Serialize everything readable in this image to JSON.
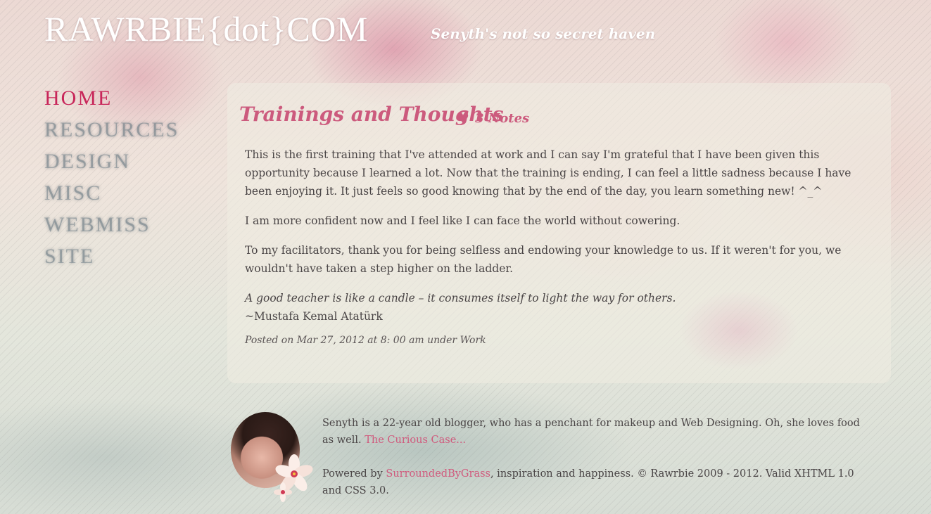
{
  "header": {
    "site_title": "RAWRBIE{dot}COM",
    "tagline": "Senyth's not so secret haven"
  },
  "nav": {
    "items": [
      {
        "label": "HOME",
        "active": true
      },
      {
        "label": "RESOURCES",
        "active": false
      },
      {
        "label": "DESIGN",
        "active": false
      },
      {
        "label": "MISC",
        "active": false
      },
      {
        "label": "WEBMISS",
        "active": false
      },
      {
        "label": "SITE",
        "active": false
      }
    ]
  },
  "post": {
    "title": "Trainings and Thoughts",
    "notes_label": "3 Notes",
    "heart_icon": "heart-icon",
    "paragraphs": [
      "This is the first training that I've attended at work and I can say I'm grateful that I have been given this opportunity because I learned a lot. Now that the training is ending, I can feel a little sadness because I have been enjoying it. It just feels so good knowing that by the end of the day, you learn something new! ^_^",
      "I am more confident now and I feel like I can face the world without cowering.",
      "To my facilitators, thank you for being selfless and endowing your knowledge to us. If it weren't for you, we wouldn't have taken a step higher on the ladder."
    ],
    "quote": "A good teacher is like a candle – it consumes itself to light the way for others.",
    "quote_attribution": "~Mustafa Kemal Atatürk",
    "meta": {
      "prefix": "Posted on ",
      "date": "Mar 27, 2012 at 8: 00 am",
      "under": " under ",
      "category": "Work"
    }
  },
  "footer": {
    "bio": "Senyth is a 22-year old blogger, who has a penchant for makeup and Web Designing. Oh, she loves food as well. ",
    "bio_link": "The Curious Case...",
    "powered_prefix": "Powered by ",
    "powered_link": "SurroundedByGrass",
    "powered_suffix": ", inspiration and happiness. © Rawrbie 2009 - 2012. Valid XHTML 1.0 and CSS 3.0."
  },
  "colors": {
    "accent": "#cc5a7d",
    "nav_active": "#c8265a",
    "link": "#d05a7d",
    "text": "#4a4546"
  }
}
